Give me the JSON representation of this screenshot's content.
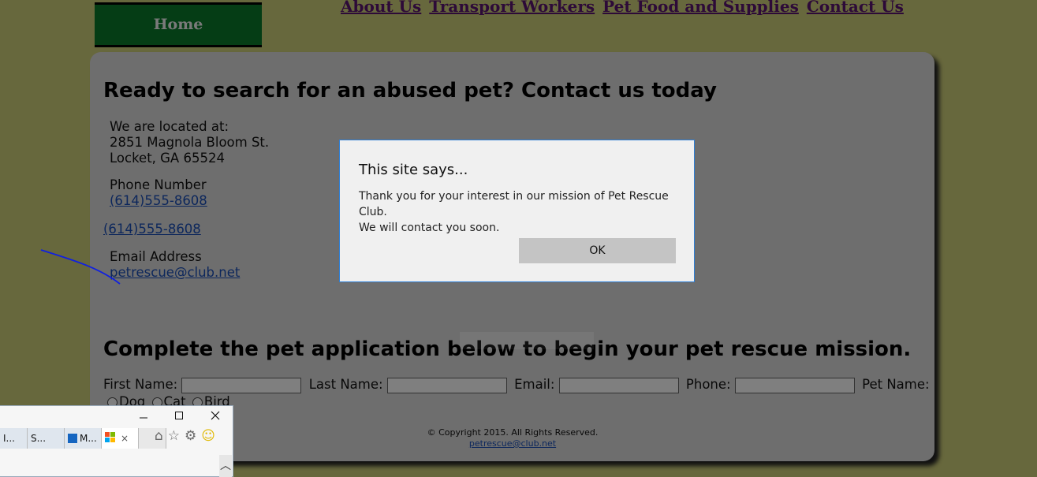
{
  "nav": {
    "home": "Home",
    "links": [
      "About Us",
      "Transport Workers",
      "Pet Food and Supplies",
      "Contact Us"
    ]
  },
  "main": {
    "heading": "Ready to search for an abused pet? Contact us today",
    "located_label": "We are located at:",
    "address_line1": "2851 Magnola Bloom St.",
    "address_line2": "Locket, GA 65524",
    "phone_label": "Phone Number",
    "phone1": "(614)555-8608",
    "phone2": "(614)555-8608",
    "email_label": "Email Address",
    "email": "petrescue@club.net",
    "form_heading": "Complete the pet application below to begin your pet rescue mission.",
    "form_labels": [
      "First Name:",
      "Last Name:",
      "Email:",
      "Phone:",
      "Pet Name:"
    ],
    "radio_labels": [
      "Dog",
      "Cat",
      "Bird"
    ]
  },
  "footer": {
    "copyright": "© Copyright 2015. All Rights Reserved.",
    "email": "petrescue@club.net"
  },
  "dialog": {
    "title": "This site says...",
    "message_line1": "Thank you for your interest in our mission of Pet Rescue Club.",
    "message_line2": "We will contact you soon.",
    "ok_label": "OK"
  },
  "browser": {
    "tabs": [
      "I...",
      "S...",
      "M...",
      ""
    ],
    "close_tab": "×"
  },
  "colors": {
    "page_bg": "#cfd07a",
    "home_bg": "#0a7a2a",
    "link": "#5a1470",
    "dialog_border": "#2e7fd6"
  }
}
